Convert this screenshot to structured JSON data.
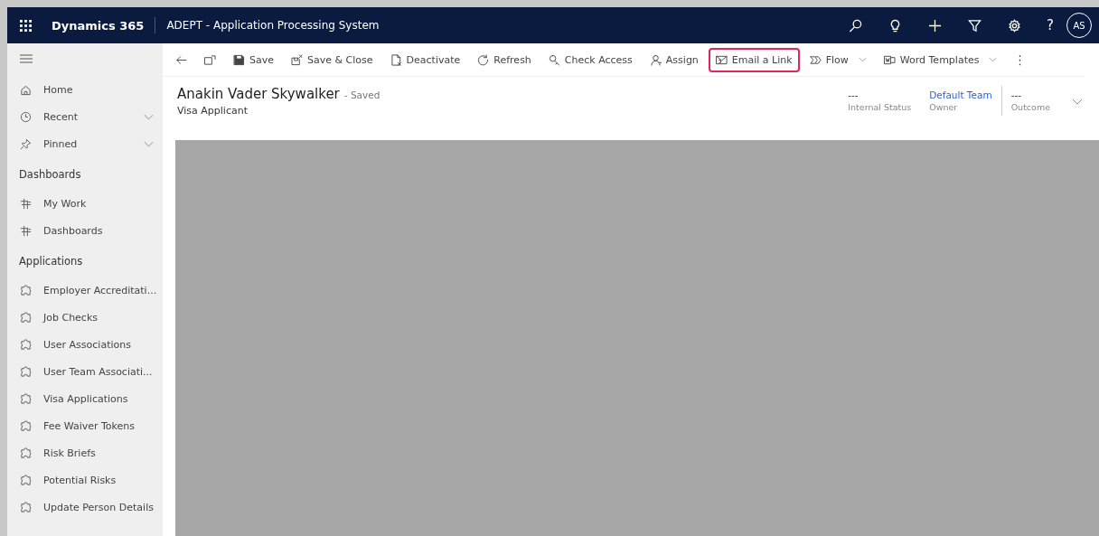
{
  "top_bar": {
    "app_name": "Dynamics 365",
    "title": "ADEPT - Application Processing System",
    "help": "?",
    "avatar": "AS"
  },
  "sidebar": {
    "top_items": [
      {
        "label": "Home",
        "expandable": false
      },
      {
        "label": "Recent",
        "expandable": true
      },
      {
        "label": "Pinned",
        "expandable": true
      }
    ],
    "sections": [
      {
        "title": "Dashboards",
        "items": [
          {
            "label": "My Work"
          },
          {
            "label": "Dashboards"
          }
        ]
      },
      {
        "title": "Applications",
        "items": [
          {
            "label": "Employer Accreditati..."
          },
          {
            "label": "Job Checks"
          },
          {
            "label": "User Associations"
          },
          {
            "label": "User Team Associati..."
          },
          {
            "label": "Visa Applications"
          },
          {
            "label": "Fee Waiver Tokens"
          },
          {
            "label": "Risk Briefs"
          },
          {
            "label": "Potential Risks"
          },
          {
            "label": "Update Person Details"
          }
        ]
      }
    ]
  },
  "command_bar": [
    {
      "highlighted": false,
      "menu": false
    },
    {
      "highlighted": false,
      "menu": false
    },
    {
      "label": "Save",
      "highlighted": false,
      "menu": false
    },
    {
      "label": "Save & Close",
      "highlighted": false,
      "menu": false
    },
    {
      "label": "Deactivate",
      "highlighted": false,
      "menu": false
    },
    {
      "label": "Refresh",
      "highlighted": false,
      "menu": false
    },
    {
      "label": "Check Access",
      "highlighted": false,
      "menu": false
    },
    {
      "label": "Assign",
      "highlighted": false,
      "menu": false
    },
    {
      "label": "Email a Link",
      "highlighted": true,
      "menu": false
    },
    {
      "label": "Flow",
      "highlighted": false,
      "menu": true
    },
    {
      "label": "Word Templates",
      "highlighted": false,
      "menu": true
    },
    {
      "highlighted": false,
      "menu": false
    }
  ],
  "record": {
    "name": "Anakin Vader Skywalker",
    "status": "- Saved",
    "entity": "Visa Applicant",
    "header_fields": [
      {
        "value": "---",
        "label": "Internal Status",
        "kind": "plain"
      },
      {
        "value": "Default Team",
        "label": "Owner",
        "kind": "link"
      },
      {
        "value": "---",
        "label": "Outcome",
        "kind": "plain"
      }
    ]
  }
}
